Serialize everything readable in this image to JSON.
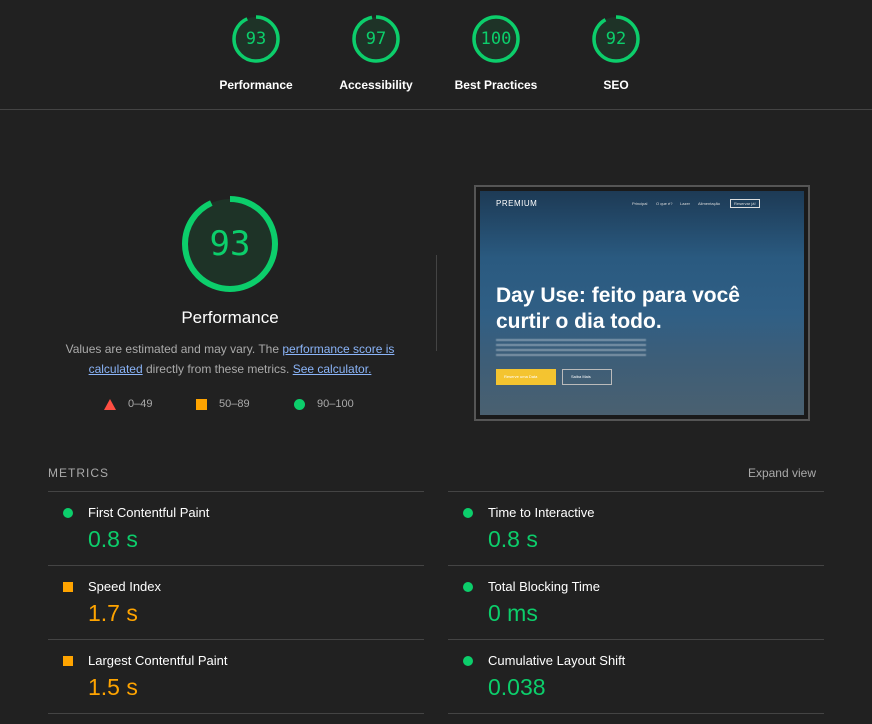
{
  "colors": {
    "pass": "#0cce6b",
    "average": "#ffa400",
    "fail": "#ff4e42",
    "link": "#8ab4f8"
  },
  "gauges": [
    {
      "label": "Performance",
      "score": "93"
    },
    {
      "label": "Accessibility",
      "score": "97"
    },
    {
      "label": "Best Practices",
      "score": "100"
    },
    {
      "label": "SEO",
      "score": "92"
    }
  ],
  "performance": {
    "score": "93",
    "title": "Performance",
    "desc_pre": "Values are estimated and may vary. The ",
    "link1": "performance score is calculated",
    "desc_mid": " directly from these metrics. ",
    "link2": "See calculator.",
    "legend": [
      {
        "icon": "triangle-icon",
        "range": "0–49"
      },
      {
        "icon": "square-icon",
        "range": "50–89"
      },
      {
        "icon": "circle-icon",
        "range": "90–100"
      }
    ]
  },
  "screenshot": {
    "logo": "PREMIUM",
    "nav": [
      "Principal",
      "O que é?",
      "Lazer",
      "Alimentação",
      "Reservar já!"
    ],
    "headline": "Day Use: feito para você curtir o dia todo.",
    "button1": "Reserve uma Data",
    "button2": "Saiba Mais"
  },
  "metrics": {
    "heading": "METRICS",
    "expand": "Expand view",
    "left": [
      {
        "label": "First Contentful Paint",
        "value": "0.8 s",
        "status": "pass"
      },
      {
        "label": "Speed Index",
        "value": "1.7 s",
        "status": "average"
      },
      {
        "label": "Largest Contentful Paint",
        "value": "1.5 s",
        "status": "average"
      }
    ],
    "right": [
      {
        "label": "Time to Interactive",
        "value": "0.8 s",
        "status": "pass"
      },
      {
        "label": "Total Blocking Time",
        "value": "0 ms",
        "status": "pass"
      },
      {
        "label": "Cumulative Layout Shift",
        "value": "0.038",
        "status": "pass"
      }
    ]
  }
}
